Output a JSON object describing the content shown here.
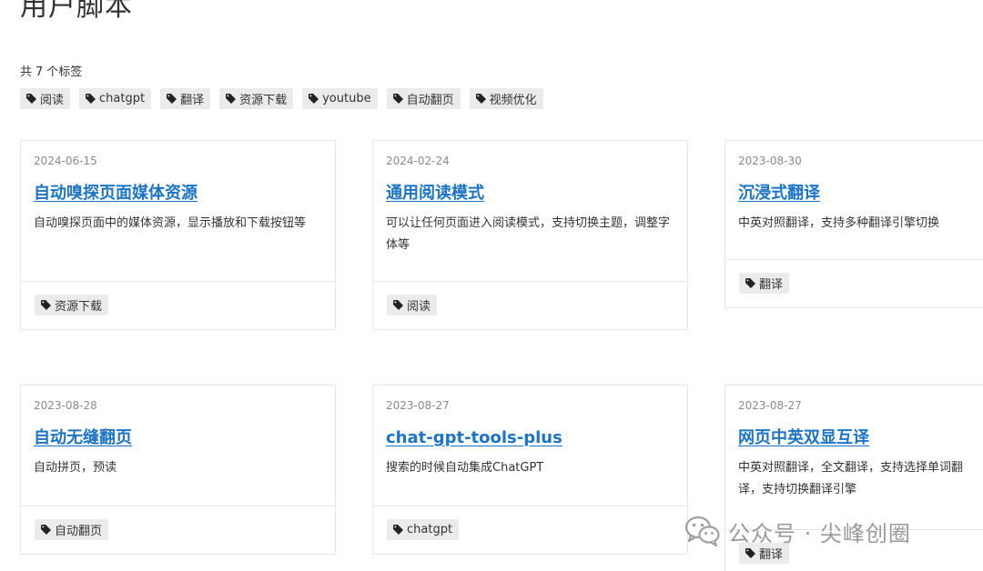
{
  "page": {
    "title": "用户脚本",
    "tag_count_prefix": "共",
    "tag_count": "7",
    "tag_count_suffix": "个标签"
  },
  "tags": [
    "阅读",
    "chatgpt",
    "翻译",
    "资源下载",
    "youtube",
    "自动翻页",
    "视频优化"
  ],
  "cards": [
    {
      "date": "2024-06-15",
      "title": "自动嗅探页面媒体资源",
      "desc": "自动嗅探页面中的媒体资源，显示播放和下载按钮等",
      "tag": "资源下载"
    },
    {
      "date": "2024-02-24",
      "title": "通用阅读模式",
      "desc": "可以让任何页面进入阅读模式，支持切换主题，调整字体等",
      "tag": "阅读"
    },
    {
      "date": "2023-08-30",
      "title": "沉浸式翻译",
      "desc": "中英对照翻译，支持多种翻译引擎切换",
      "tag": "翻译"
    },
    {
      "date": "2023-08-28",
      "title": "自动无缝翻页",
      "desc": "自动拼页，预读",
      "tag": "自动翻页"
    },
    {
      "date": "2023-08-27",
      "title": "chat-gpt-tools-plus",
      "desc": "搜索的时候自动集成ChatGPT",
      "tag": "chatgpt"
    },
    {
      "date": "2023-08-27",
      "title": "网页中英双显互译",
      "desc": "中英对照翻译，全文翻译，支持选择单词翻译，支持切换翻译引擎",
      "tag": "翻译"
    }
  ],
  "watermark": {
    "text": "公众号 · 尖峰创圈",
    "icon": "wechat-icon"
  },
  "colors": {
    "link": "#1b74c5",
    "tag_bg": "#ebebeb",
    "border": "#e6e6e6"
  }
}
